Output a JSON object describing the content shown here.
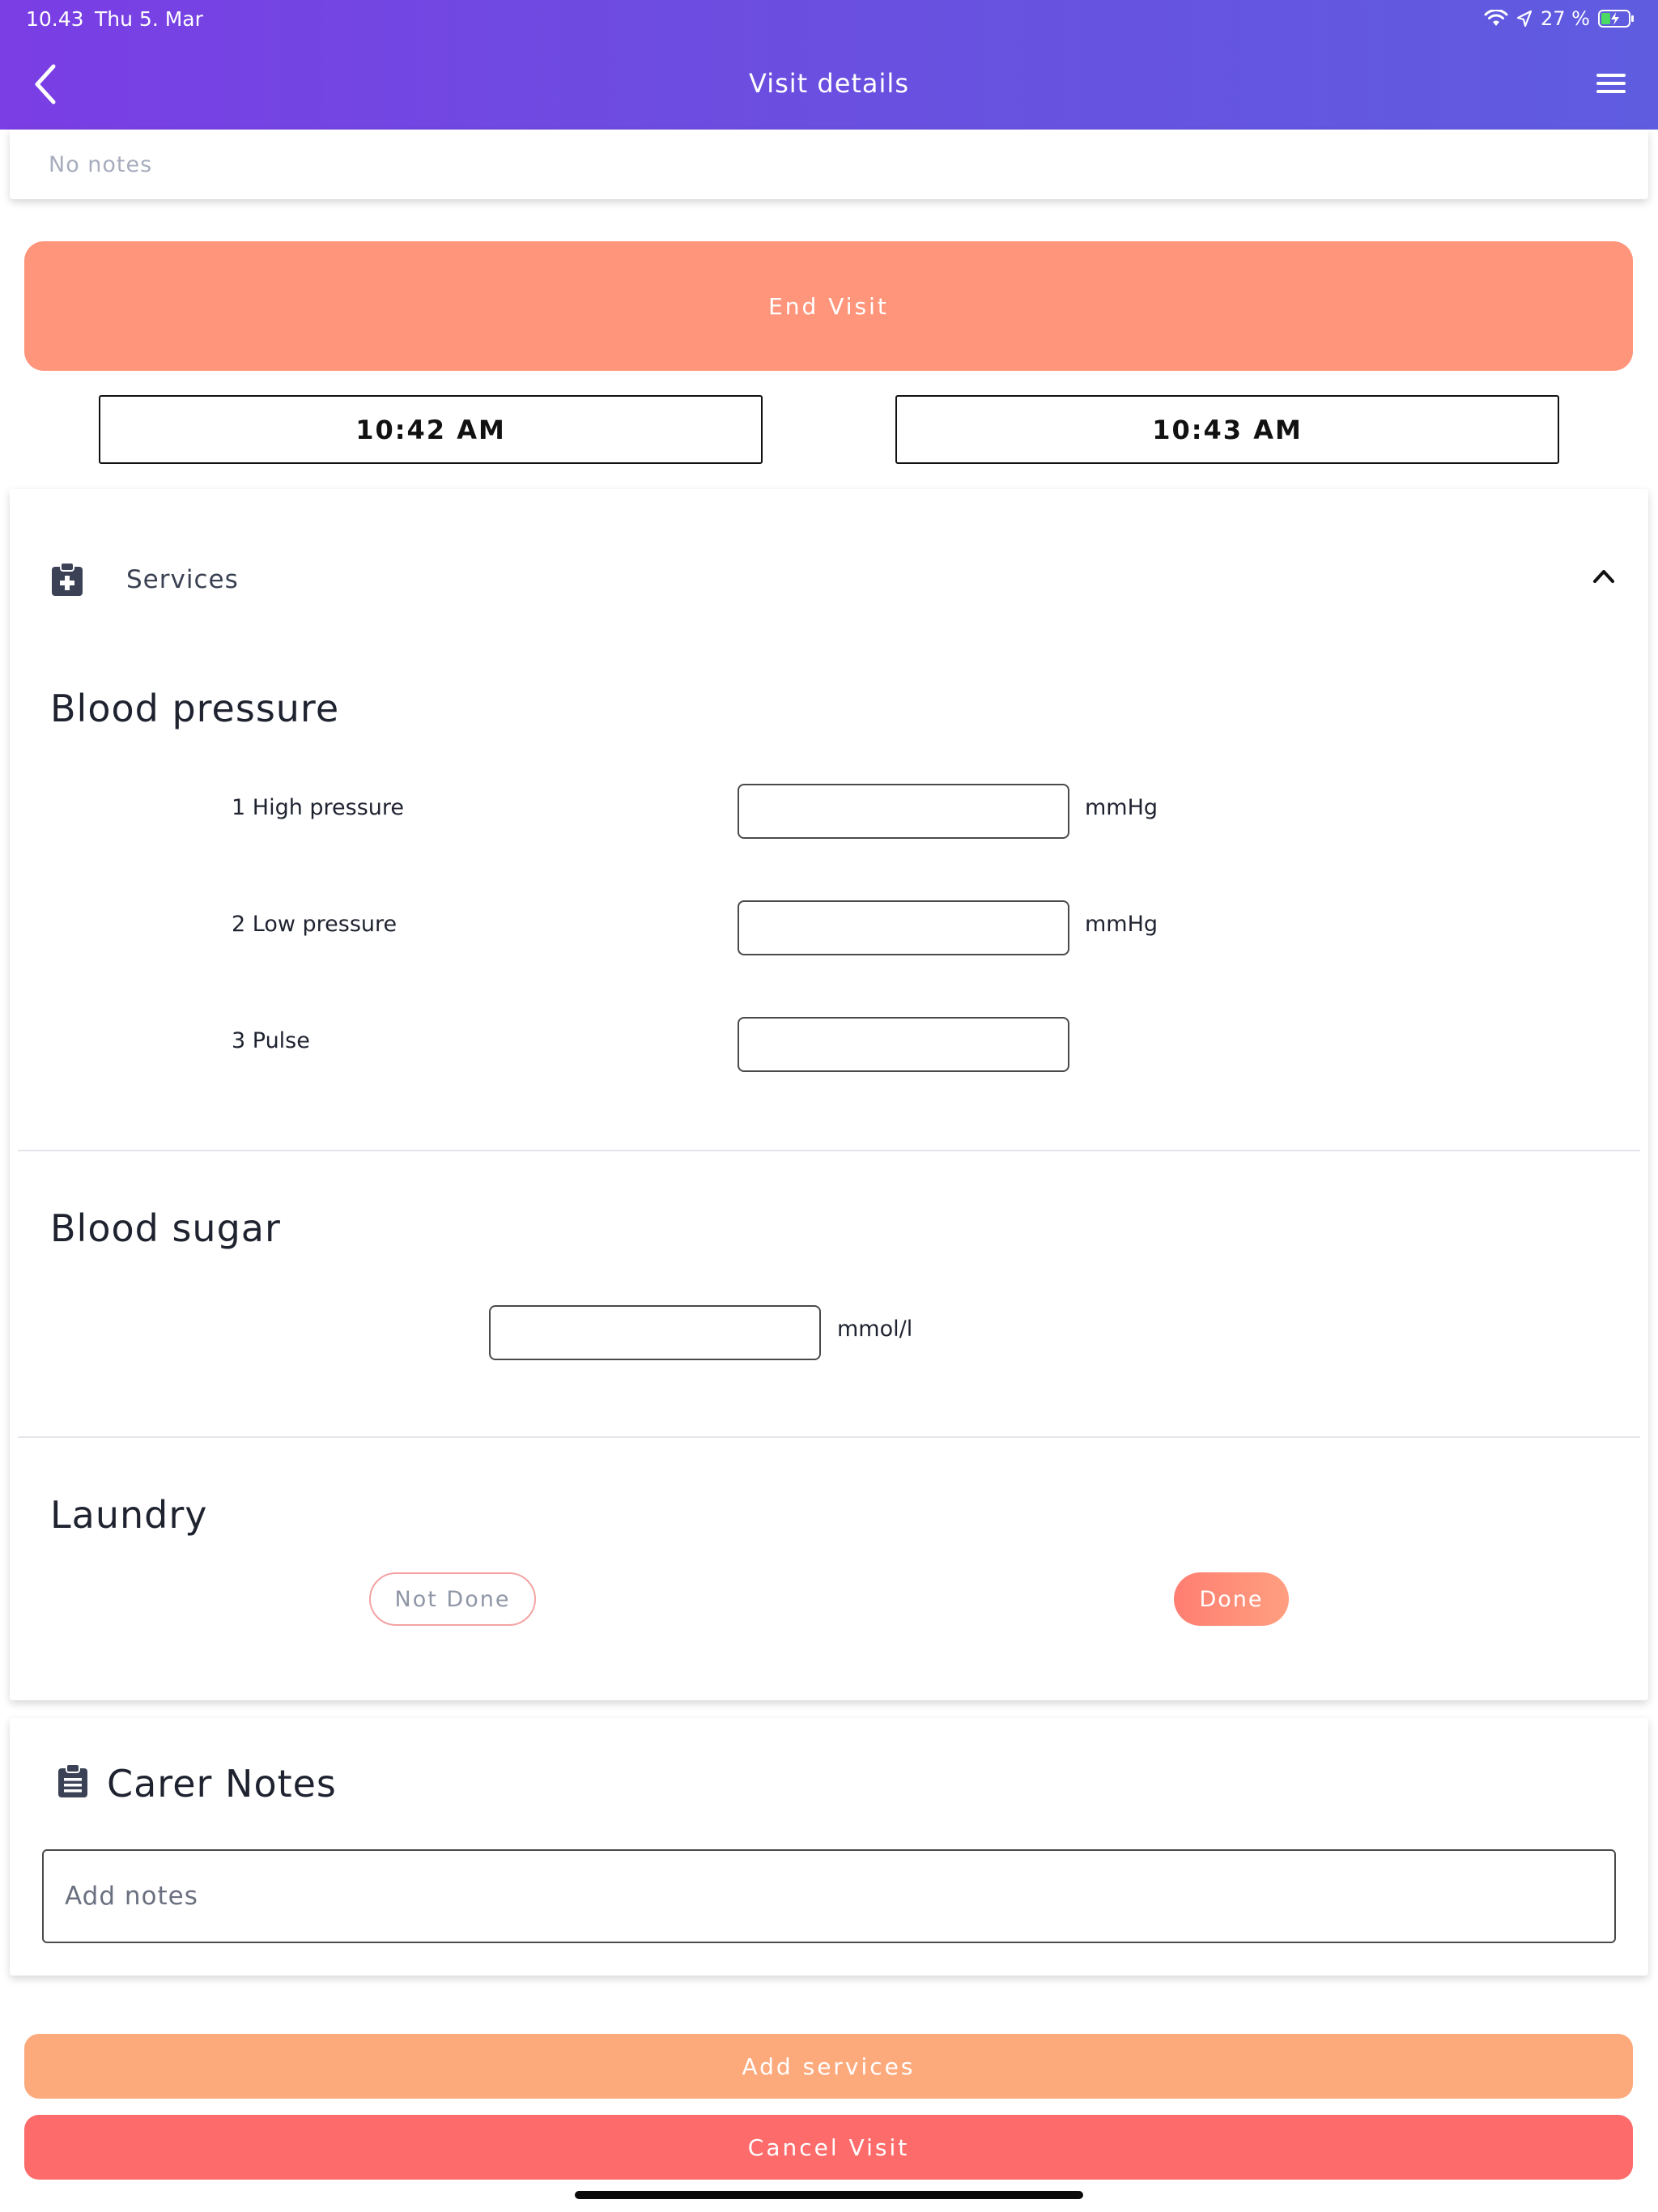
{
  "status_bar": {
    "time": "10.43",
    "date": "Thu 5. Mar",
    "battery_pct": "27 %",
    "icons": [
      "wifi-icon",
      "location-arrow-icon",
      "battery-charging-icon"
    ]
  },
  "header": {
    "title": "Visit details",
    "back_icon": "chevron-left-icon",
    "menu_icon": "hamburger-menu-icon",
    "gradient_colors": [
      "#7a3ee4",
      "#5f5ce0"
    ]
  },
  "visit_notes": {
    "text": "No notes"
  },
  "end_visit": {
    "label": "End Visit",
    "color": "#ff967c"
  },
  "times": {
    "start": "10:42 AM",
    "end": "10:43 AM"
  },
  "services": {
    "label": "Services",
    "icon": "medical-clipboard-icon",
    "collapse_icon": "chevron-up-icon",
    "blood_pressure": {
      "title": "Blood pressure",
      "fields": [
        {
          "label": "1 High pressure",
          "value": "",
          "unit": "mmHg"
        },
        {
          "label": "2 Low pressure",
          "value": "",
          "unit": "mmHg"
        },
        {
          "label": "3 Pulse",
          "value": "",
          "unit": ""
        }
      ]
    },
    "blood_sugar": {
      "title": "Blood sugar",
      "value": "",
      "unit": "mmol/l"
    },
    "laundry": {
      "title": "Laundry",
      "not_done_label": "Not Done",
      "done_label": "Done",
      "selected": "Done"
    }
  },
  "carer_notes": {
    "title": "Carer Notes",
    "icon": "clipboard-list-icon",
    "placeholder": "Add notes",
    "value": ""
  },
  "actions": {
    "add_services": "Add services",
    "cancel_visit": "Cancel Visit",
    "add_color": "#fcaa7c",
    "cancel_color": "#fe6b6b"
  }
}
